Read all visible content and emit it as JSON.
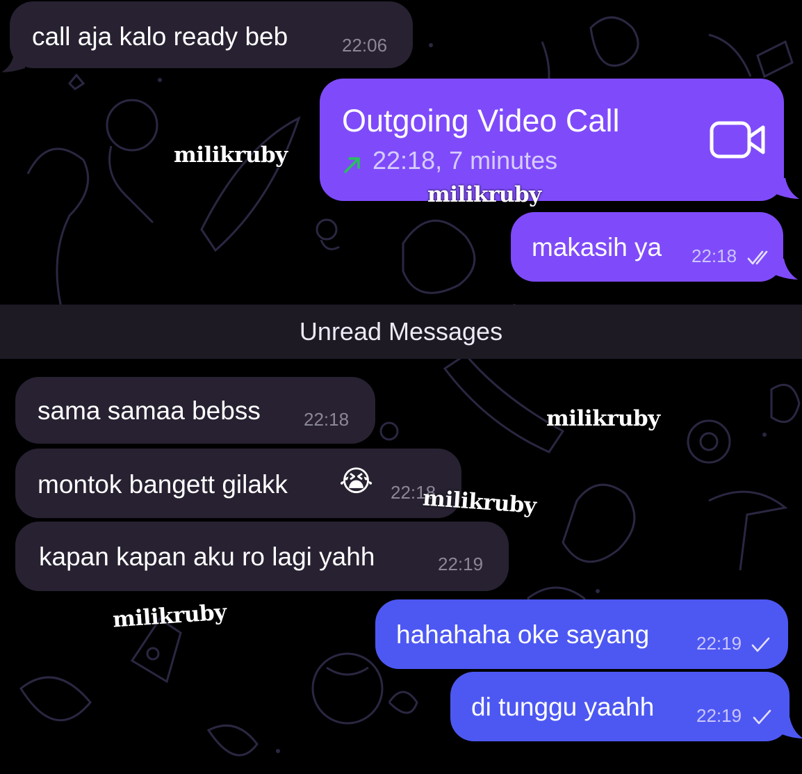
{
  "colors": {
    "background": "#000000",
    "incoming_bubble": "#272131",
    "outgoing_bubble_violet": "#7f4bfa",
    "outgoing_bubble_blue": "#4d58f2",
    "outgoing_arrow": "#27c15b",
    "unread_bar": "#1d1a24"
  },
  "messages": [
    {
      "text": "call aja kalo ready beb",
      "time": "22:06",
      "direction": "incoming"
    },
    {
      "text": "makasih ya",
      "time": "22:18",
      "direction": "outgoing",
      "status": "double-check-icon"
    },
    {
      "text": "sama samaa bebss",
      "time": "22:18",
      "direction": "incoming"
    },
    {
      "text": "montok bangett gilakk",
      "emoji": "😭",
      "time": "22:18",
      "direction": "incoming"
    },
    {
      "text": "kapan kapan aku ro lagi yahh",
      "time": "22:19",
      "direction": "incoming"
    },
    {
      "text": "hahahaha oke sayang",
      "time": "22:19",
      "direction": "outgoing",
      "status": "single-check-icon"
    },
    {
      "text": "di tunggu yaahh",
      "time": "22:19",
      "direction": "outgoing",
      "status": "single-check-icon"
    }
  ],
  "call": {
    "title": "Outgoing Video Call",
    "detail": "22:18, 7 minutes",
    "direction_icon": "outgoing-arrow-icon",
    "action_icon": "video-camera-icon"
  },
  "unread_divider": "Unread Messages",
  "watermark_text": "milikruby"
}
